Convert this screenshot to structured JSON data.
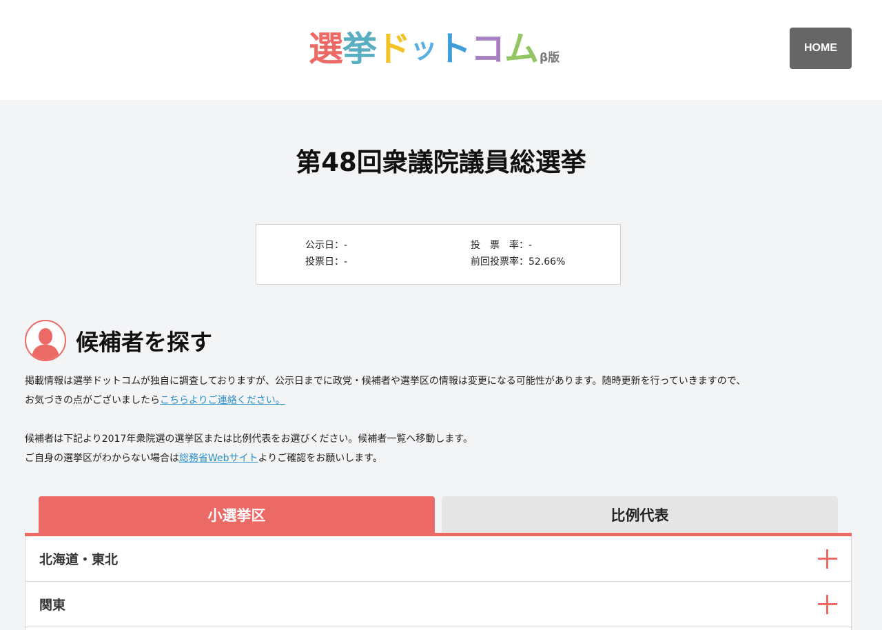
{
  "header": {
    "logo": {
      "chars": [
        {
          "char": "選",
          "color": "#ec6a65"
        },
        {
          "char": "挙",
          "color": "#5aaec2"
        },
        {
          "char": "ド",
          "color": "#f2c227"
        },
        {
          "char": "ッ",
          "color": "#59b0e0"
        },
        {
          "char": "ト",
          "color": "#3f9ed8"
        },
        {
          "char": "コ",
          "color": "#a57fc0"
        },
        {
          "char": "ム",
          "color": "#93c565"
        },
        {
          "char": "β版",
          "color": "#7a7a7a"
        }
      ],
      "extra": ""
    },
    "home_label": "HOME"
  },
  "page_title": "第48回衆議院議員総選挙",
  "info": {
    "announce": "公示日：-",
    "vote_day": "投票日：-",
    "turnout": "投　票　率：-",
    "prev_turnout": "前回投票率：52.66%"
  },
  "search": {
    "icon": "person-icon",
    "title": "候補者を探す",
    "para1_line1": "掲載情報は選挙ドットコムが独自に調査しておりますが、公示日までに政党・候補者や選挙区の情報は変更になる可能性があります。随時更新を行っていきますので、",
    "para1_line2": "お気づきの点がございましたら",
    "para1_link": "こちらよりご連絡ください。",
    "para2_line1": "候補者は下記より2017年衆院選の選挙区または比例代表をお選びください。候補者一覧へ移動します。",
    "para2_line2_pre": "ご自身の選挙区がわからない場合は",
    "para2_link": "総務省Webサイト",
    "para2_line2_post": "よりご確認をお願いします。"
  },
  "tabs": [
    {
      "label": "小選挙区",
      "active": true
    },
    {
      "label": "比例代表",
      "active": false
    }
  ],
  "regions": [
    {
      "label": "北海道・東北"
    },
    {
      "label": "関東"
    }
  ],
  "colors": {
    "accent": "#ec6a65",
    "link": "#2a8fc7",
    "home_button": "#666666"
  }
}
